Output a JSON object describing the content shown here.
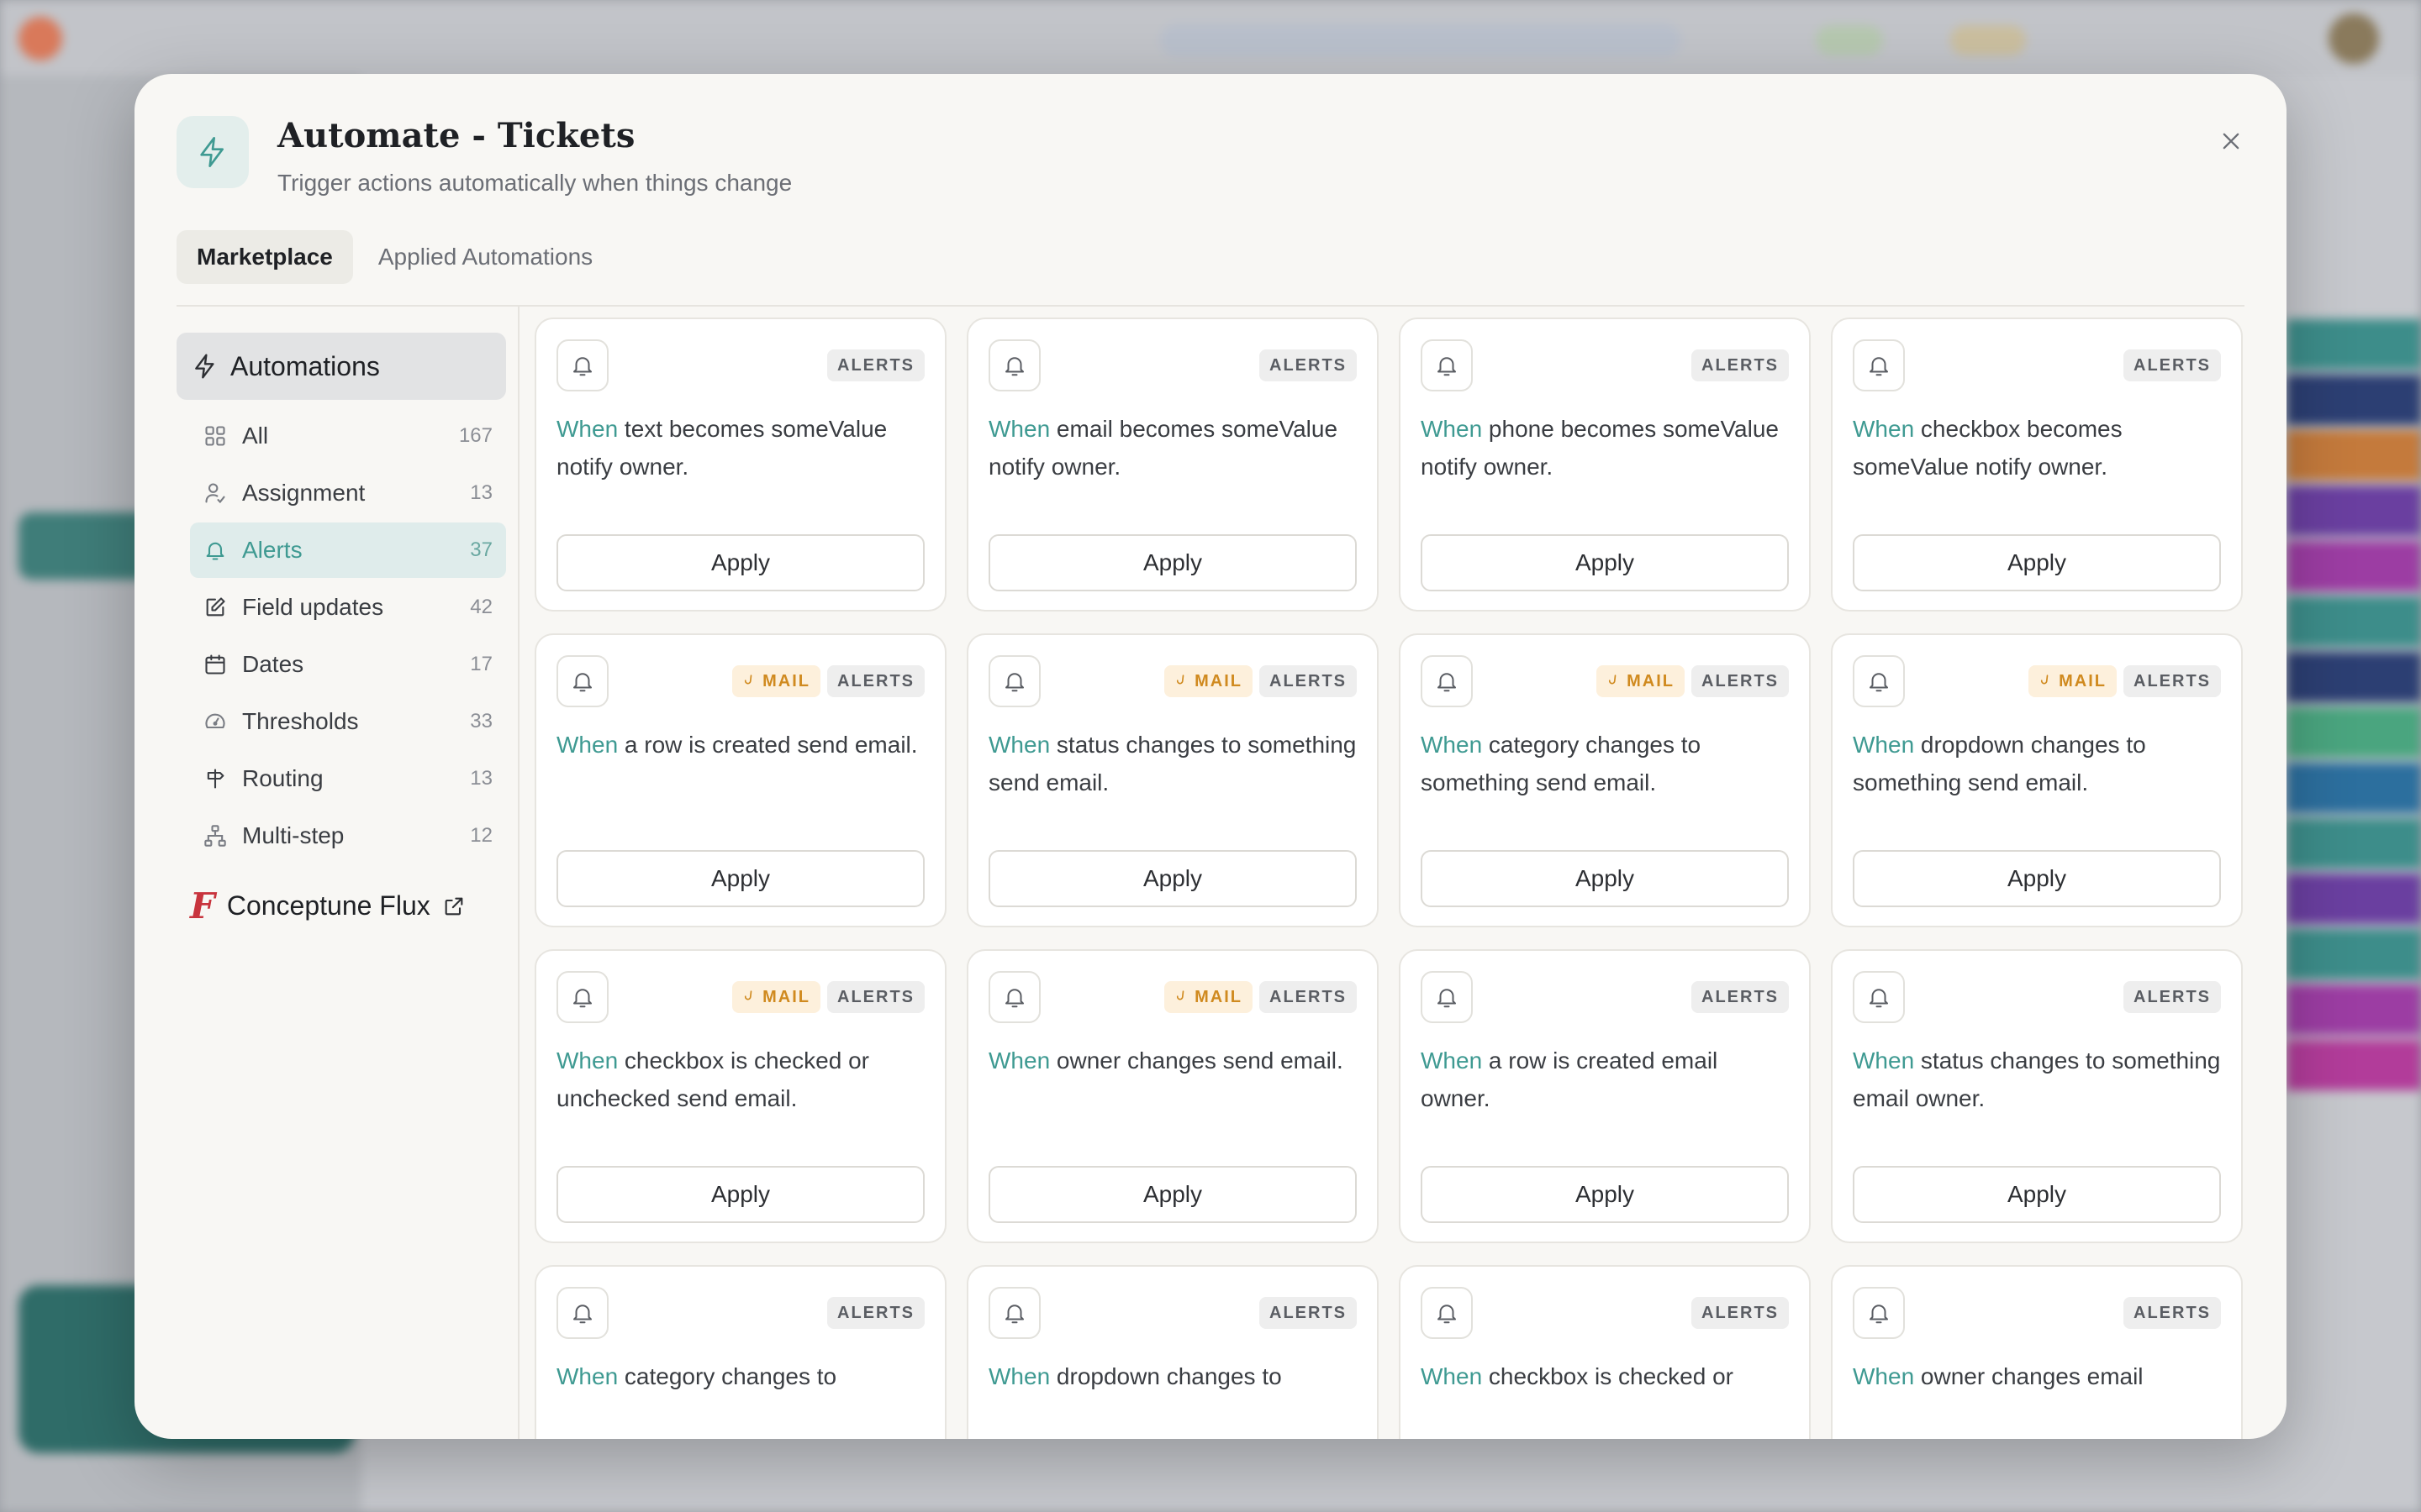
{
  "modal": {
    "title": "Automate - Tickets",
    "subtitle": "Trigger actions automatically when things change",
    "accent_color": "#3f9a92"
  },
  "tabs": [
    {
      "label": "Marketplace",
      "active": true
    },
    {
      "label": "Applied Automations",
      "active": false
    }
  ],
  "sidebar": {
    "header": "Automations",
    "items": [
      {
        "label": "All",
        "count": "167",
        "icon": "grid-icon",
        "active": false
      },
      {
        "label": "Assignment",
        "count": "13",
        "icon": "user-check-icon",
        "active": false
      },
      {
        "label": "Alerts",
        "count": "37",
        "icon": "bell-icon",
        "active": true
      },
      {
        "label": "Field updates",
        "count": "42",
        "icon": "edit-icon",
        "active": false
      },
      {
        "label": "Dates",
        "count": "17",
        "icon": "calendar-icon",
        "active": false
      },
      {
        "label": "Thresholds",
        "count": "33",
        "icon": "gauge-icon",
        "active": false
      },
      {
        "label": "Routing",
        "count": "13",
        "icon": "signpost-icon",
        "active": false
      },
      {
        "label": "Multi-step",
        "count": "12",
        "icon": "network-icon",
        "active": false
      }
    ],
    "brand_link": {
      "label": "Conceptune Flux",
      "mark": "F"
    }
  },
  "tags": {
    "mail": "MAIL",
    "alerts": "ALERTS"
  },
  "apply_label": "Apply",
  "cards": [
    {
      "when": "When",
      "text": " text becomes someValue notify owner.",
      "mail": false
    },
    {
      "when": "When",
      "text": " email becomes someValue notify owner.",
      "mail": false
    },
    {
      "when": "When",
      "text": " phone becomes someValue notify owner.",
      "mail": false
    },
    {
      "when": "When",
      "text": " checkbox becomes someValue notify owner.",
      "mail": false
    },
    {
      "when": "When",
      "text": " a row is created send email.",
      "mail": true
    },
    {
      "when": "When",
      "text": " status changes to something send email.",
      "mail": true
    },
    {
      "when": "When",
      "text": " category changes to something send email.",
      "mail": true
    },
    {
      "when": "When",
      "text": " dropdown changes to something send email.",
      "mail": true
    },
    {
      "when": "When",
      "text": " checkbox is checked or unchecked send email.",
      "mail": true
    },
    {
      "when": "When",
      "text": " owner changes send email.",
      "mail": true
    },
    {
      "when": "When",
      "text": " a row is created email owner.",
      "mail": false
    },
    {
      "when": "When",
      "text": " status changes to something email owner.",
      "mail": false
    },
    {
      "when": "When",
      "text": " category changes to",
      "mail": false
    },
    {
      "when": "When",
      "text": " dropdown changes to",
      "mail": false
    },
    {
      "when": "When",
      "text": " checkbox is checked or",
      "mail": false
    },
    {
      "when": "When",
      "text": " owner changes email",
      "mail": false
    }
  ]
}
